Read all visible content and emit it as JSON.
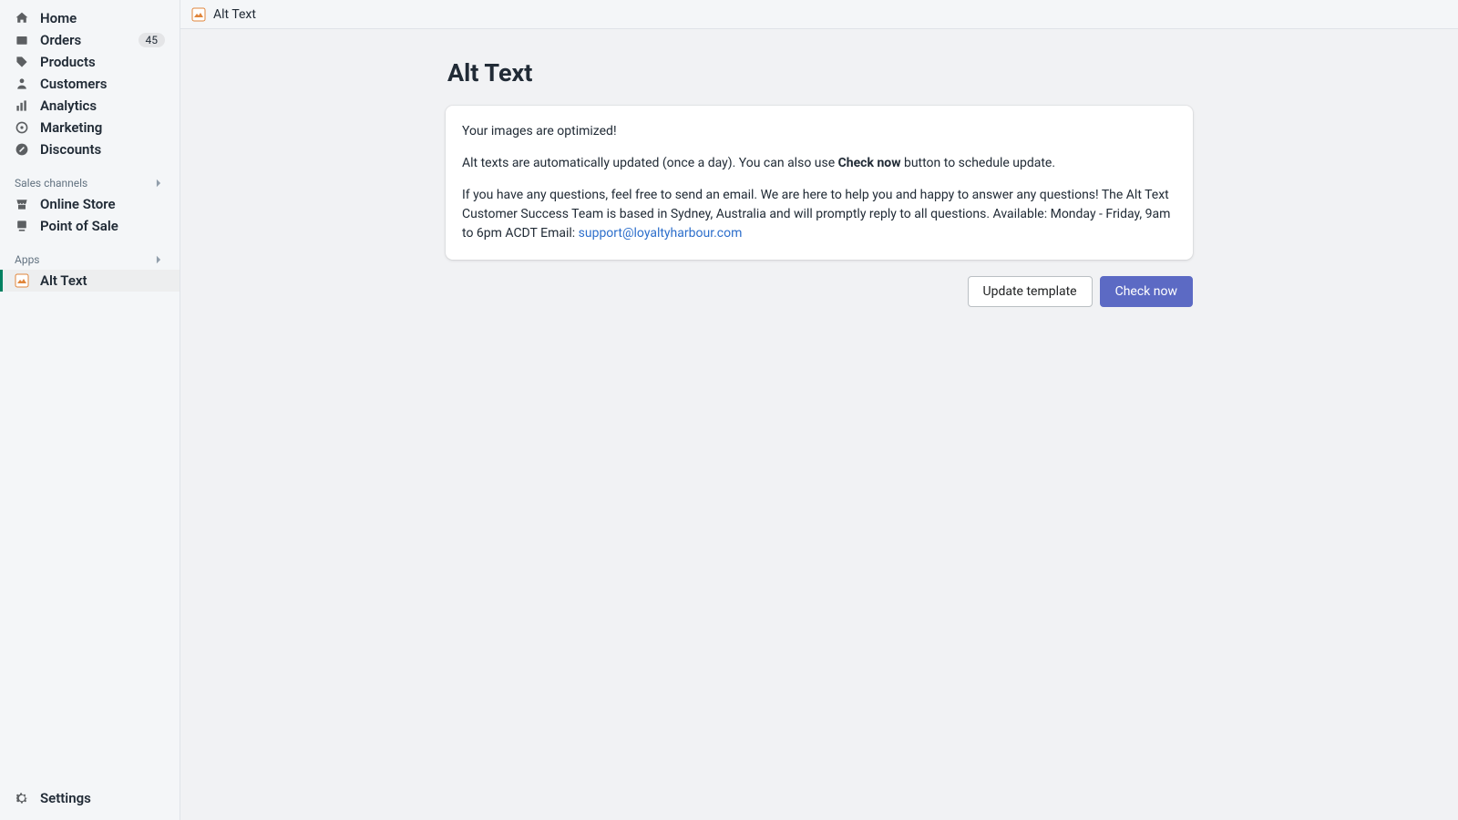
{
  "sidebar": {
    "items": [
      {
        "label": "Home"
      },
      {
        "label": "Orders",
        "badge": "45"
      },
      {
        "label": "Products"
      },
      {
        "label": "Customers"
      },
      {
        "label": "Analytics"
      },
      {
        "label": "Marketing"
      },
      {
        "label": "Discounts"
      }
    ],
    "section_sales": "Sales channels",
    "sales_items": [
      {
        "label": "Online Store"
      },
      {
        "label": "Point of Sale"
      }
    ],
    "section_apps": "Apps",
    "app_items": [
      {
        "label": "Alt Text"
      }
    ],
    "settings": "Settings"
  },
  "topbar": {
    "app_title": "Alt Text"
  },
  "page": {
    "title": "Alt Text",
    "card": {
      "line1": "Your images are optimized!",
      "line2_pre": "Alt texts are automatically updated (once a day). You can also use ",
      "line2_bold": "Check now",
      "line2_post": " button to schedule update.",
      "line3_pre": "If you have any questions, feel free to send an email. We are here to help you and happy to answer any questions! The Alt Text Customer Success Team is based in Sydney, Australia and will promptly reply to all questions. Available: Monday - Friday, 9am to 6pm ACDT Email: ",
      "support_email": "support@loyaltyharbour.com"
    },
    "actions": {
      "update_template": "Update template",
      "check_now": "Check now"
    }
  }
}
